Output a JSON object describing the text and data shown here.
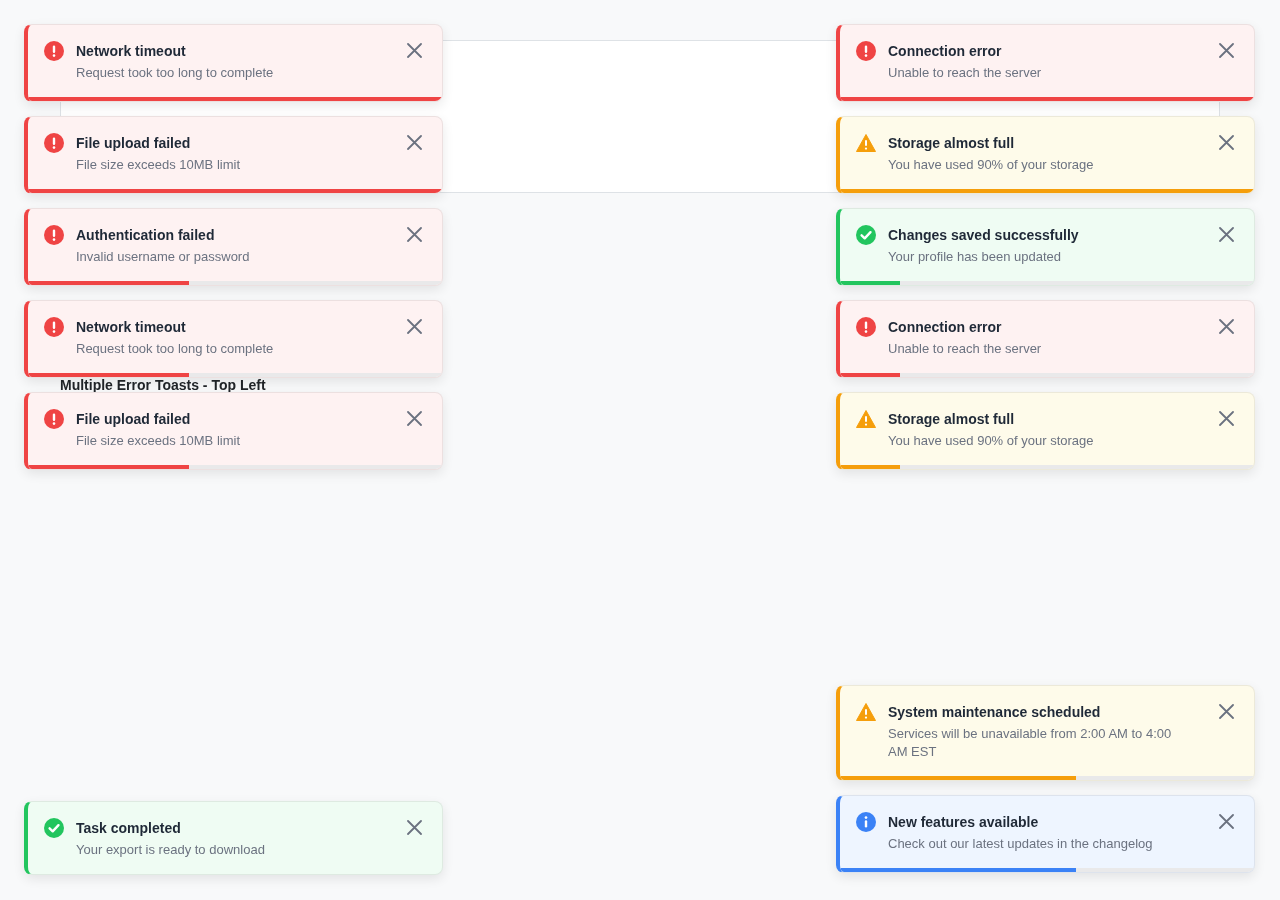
{
  "page": {
    "heading": "Multiple Error Toasts - Top Left"
  },
  "top_left_toasts": [
    {
      "kind": "error",
      "title": "Network timeout",
      "message": "Request took too long to complete",
      "level": 1
    },
    {
      "kind": "error",
      "title": "File upload failed",
      "message": "File size exceeds 10MB limit",
      "level": 1
    },
    {
      "kind": "error",
      "title": "Authentication failed",
      "message": "Invalid username or password",
      "level": 0.39
    },
    {
      "kind": "error",
      "title": "Network timeout",
      "message": "Request took too long to complete",
      "level": 0.39
    },
    {
      "kind": "error",
      "title": "File upload failed",
      "message": "File size exceeds 10MB limit",
      "level": 0.39
    }
  ],
  "top_right_toasts": [
    {
      "kind": "error",
      "title": "Connection error",
      "message": "Unable to reach the server",
      "level": 1
    },
    {
      "kind": "warning",
      "title": "Storage almost full",
      "message": "You have used 90% of your storage",
      "level": 1
    },
    {
      "kind": "success",
      "title": "Changes saved successfully",
      "message": "Your profile has been updated",
      "level": 0.145
    },
    {
      "kind": "error",
      "title": "Connection error",
      "message": "Unable to reach the server",
      "level": 0.145
    },
    {
      "kind": "warning",
      "title": "Storage almost full",
      "message": "You have used 90% of your storage",
      "level": 0.145
    }
  ],
  "bottom_left_toasts": [
    {
      "kind": "success",
      "title": "Task completed",
      "message": "Your export is ready to download"
    }
  ],
  "bottom_right_toasts": [
    {
      "kind": "warning",
      "title": "System maintenance scheduled",
      "message": "Services will be unavailable from 2:00 AM to 4:00 AM EST",
      "level": 0.57
    },
    {
      "kind": "info",
      "title": "New features available",
      "message": "Check out our latest updates in the changelog",
      "level": 0.57
    }
  ]
}
